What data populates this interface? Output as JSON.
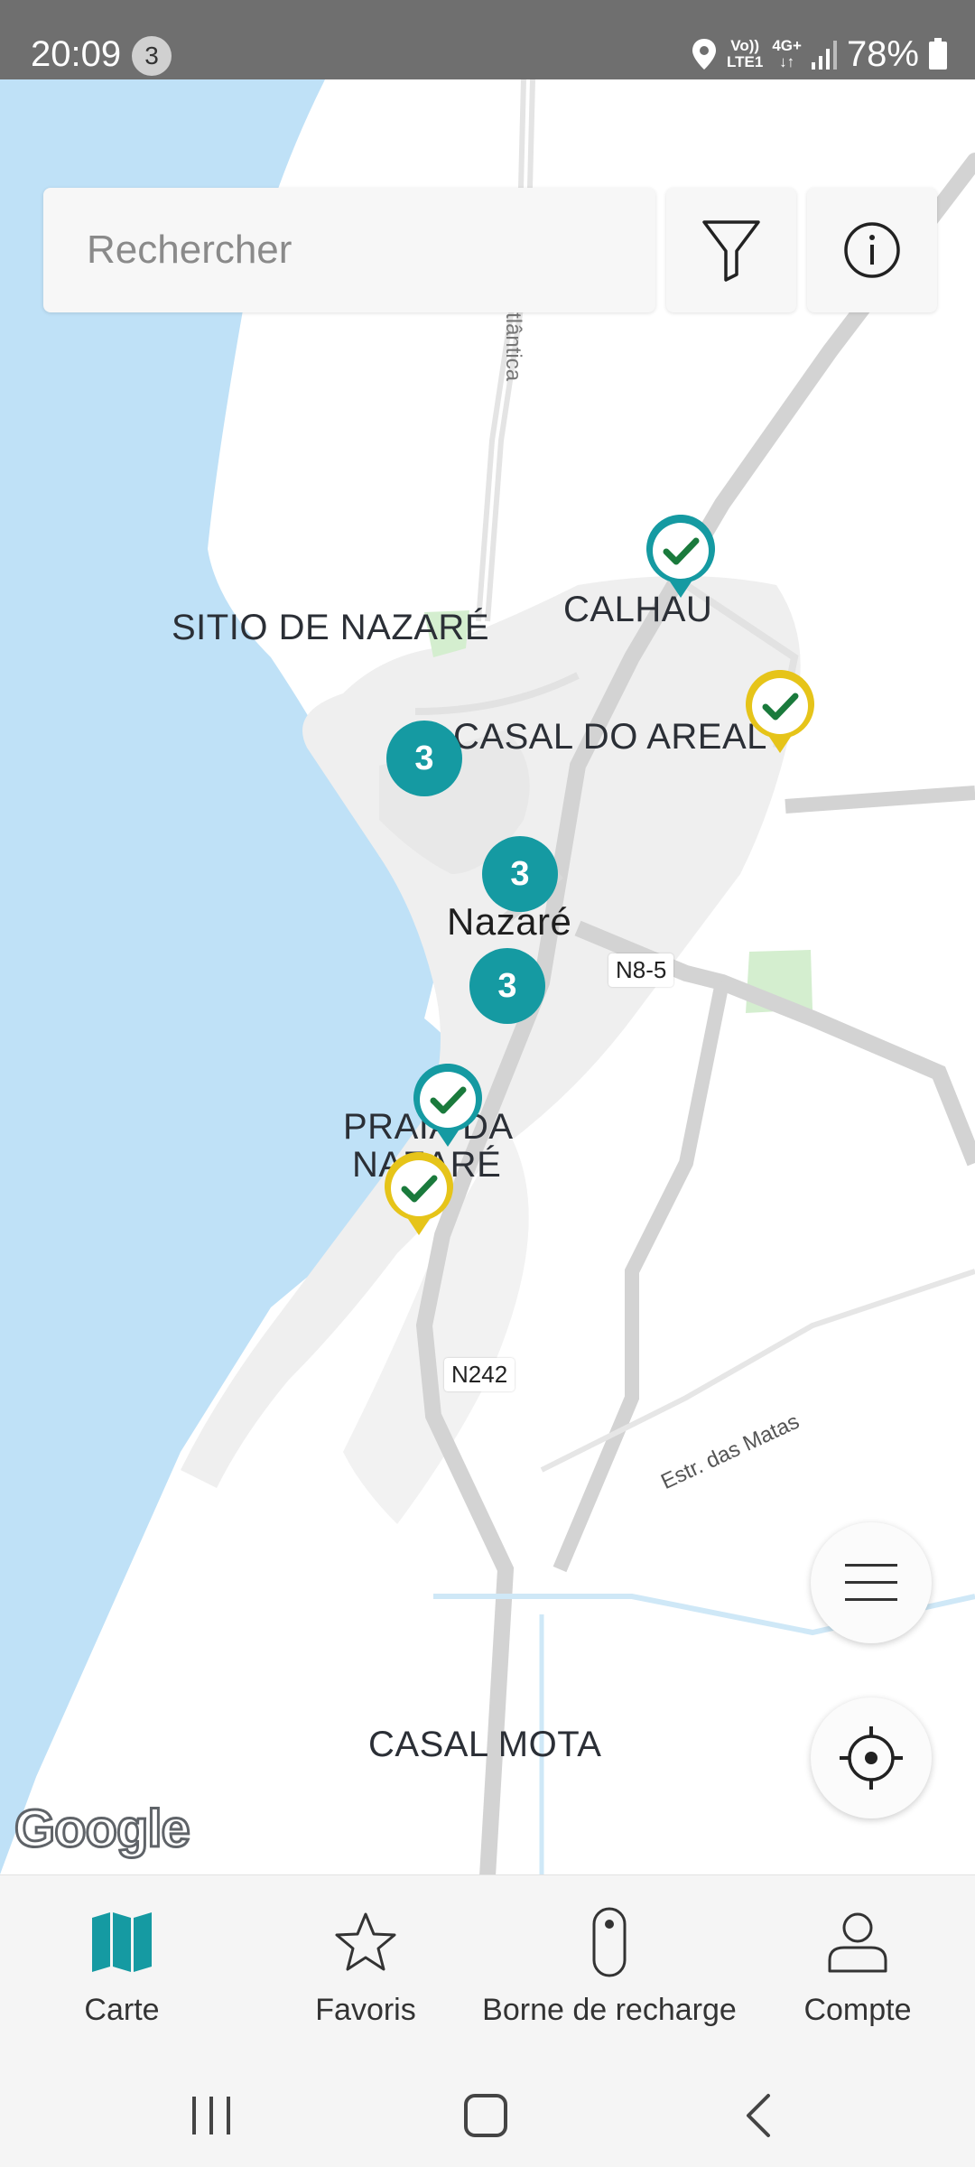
{
  "status_bar": {
    "time": "20:09",
    "notification_count": "3",
    "network_top": "Vo))",
    "network_bottom": "LTE1",
    "data_type": "4G+",
    "battery_percent": "78%",
    "icons": [
      "location-icon",
      "signal-icon",
      "battery-icon"
    ]
  },
  "search": {
    "placeholder": "Rechercher",
    "filter_icon": "filter-icon",
    "info_icon": "info-icon"
  },
  "map": {
    "places": {
      "sitio": "SITIO DE NAZARÉ",
      "calhau": "CALHAU",
      "casal_areal": "CASAL DO AREAL",
      "nazare": "Nazaré",
      "praia_line1": "PRAIA DA",
      "praia_line2": "NAZARÉ",
      "casal_mota": "CASAL MOTA"
    },
    "roads": {
      "n85": "N8-5",
      "n242": "N242",
      "matas": "Estr. das Matas",
      "atlantica": "Estrada Atlântica"
    },
    "clusters": [
      "3",
      "3",
      "3"
    ],
    "pins": [
      {
        "type": "available",
        "ring_color": "#159aa2"
      },
      {
        "type": "available",
        "ring_color": "#e6c419"
      },
      {
        "type": "available",
        "ring_color": "#159aa2"
      },
      {
        "type": "available",
        "ring_color": "#e6c419"
      }
    ],
    "check_color": "#1a7a3c",
    "attribution": "Google",
    "colors": {
      "water": "#bfe1f7",
      "land_urban": "#efefef",
      "road": "#d6d6d6",
      "park": "#d4eecf"
    }
  },
  "fabs": {
    "menu_icon": "menu-icon",
    "locate_icon": "locate-icon"
  },
  "bottom_nav": {
    "items": [
      {
        "label": "Carte",
        "icon": "map-icon",
        "active": true
      },
      {
        "label": "Favoris",
        "icon": "star-icon",
        "active": false
      },
      {
        "label": "Borne de recharge",
        "icon": "charger-icon",
        "active": false
      },
      {
        "label": "Compte",
        "icon": "account-icon",
        "active": false
      }
    ],
    "accent": "#159aa2"
  },
  "system_nav": {
    "icons": [
      "recents-icon",
      "home-icon",
      "back-icon"
    ]
  }
}
